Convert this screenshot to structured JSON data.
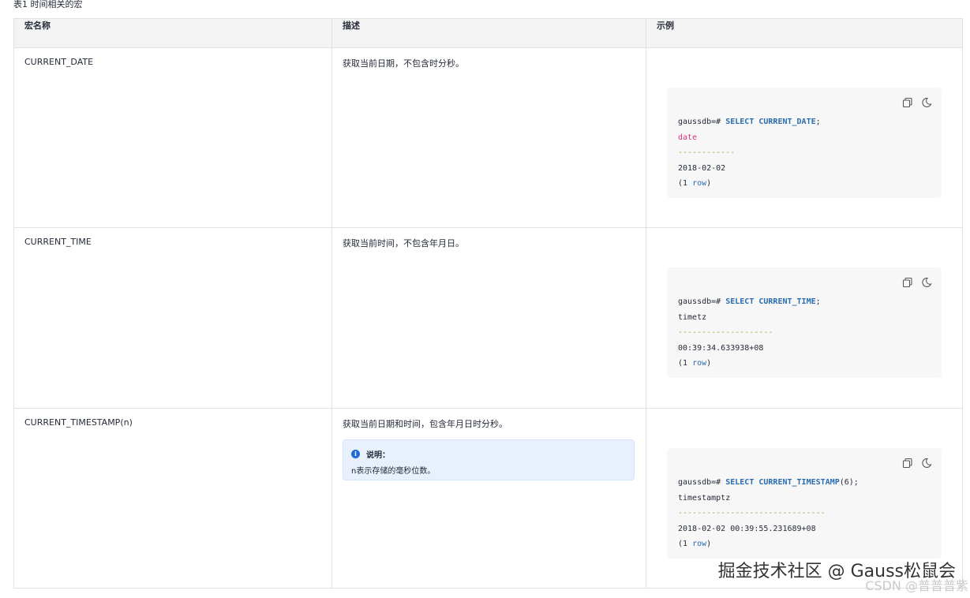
{
  "caption": "表1 时间相关的宏",
  "headers": [
    "宏名称",
    "描述",
    "示例"
  ],
  "rows": [
    {
      "name": "CURRENT_DATE",
      "desc": "获取当前日期，不包含时分秒。",
      "code": {
        "prompt": "gaussdb=# ",
        "command": "SELECT CURRENT_DATE",
        "args": "",
        "type": "date",
        "dashes": "------------",
        "value": "2018-02-02",
        "rows_open": "(",
        "rows_num": "1",
        "rows_word": "row",
        "rows_close": ")"
      }
    },
    {
      "name": "CURRENT_TIME",
      "desc": "获取当前时间，不包含年月日。",
      "code": {
        "prompt": "gaussdb=# ",
        "command": "SELECT CURRENT_TIME",
        "args": "",
        "type": "timetz",
        "dashes": "--------------------",
        "value": "00:39:34.633938+08",
        "rows_open": "(",
        "rows_num": "1",
        "rows_word": "row",
        "rows_close": ")"
      }
    },
    {
      "name": "CURRENT_TIMESTAMP(n)",
      "desc": "获取当前日期和时间，包含年月日时分秒。",
      "note": {
        "title": "说明：",
        "body": "n表示存储的毫秒位数。"
      },
      "code": {
        "prompt": "gaussdb=# ",
        "command": "SELECT CURRENT_TIMESTAMP",
        "args": "(6)",
        "type": "timestamptz",
        "dashes": "-------------------------------",
        "value": "2018-02-02 00:39:55.231689+08",
        "rows_open": "(",
        "rows_num": "1",
        "rows_word": "row",
        "rows_close": ")"
      }
    }
  ],
  "semicolon": ";",
  "icons": {
    "copy": "copy-icon",
    "theme": "dark-mode-icon"
  },
  "watermark": "掘金技术社区 @ Gauss松鼠会",
  "csdn_mark": "CSDN @普普普紫",
  "colors": {
    "keyword": "#2a6cb0",
    "type": "#d63384",
    "dashes": "#8fb03e",
    "note_bg": "#e8f0fd"
  }
}
